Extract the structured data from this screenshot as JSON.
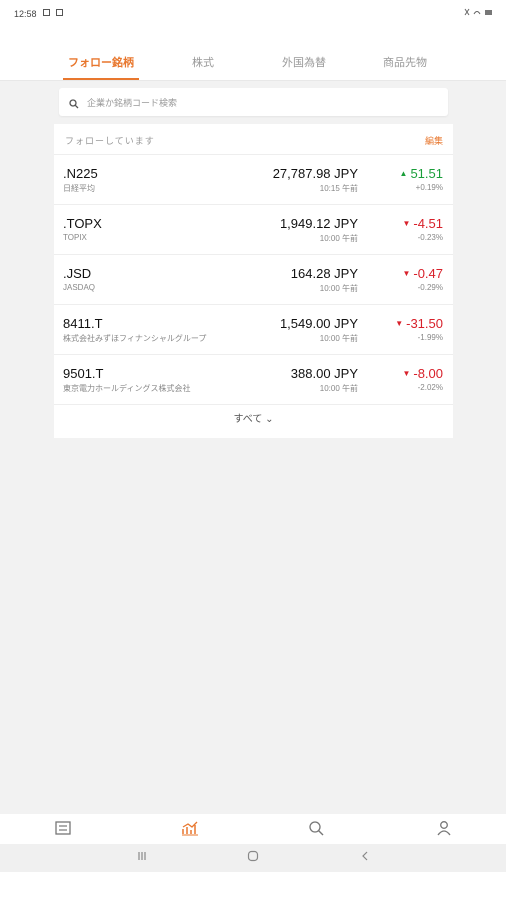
{
  "status": {
    "time": "12:58"
  },
  "tabs": [
    {
      "label": "フォロー銘柄",
      "active": true
    },
    {
      "label": "株式",
      "active": false
    },
    {
      "label": "外国為替",
      "active": false
    },
    {
      "label": "商品先物",
      "active": false
    }
  ],
  "search": {
    "placeholder": "企業か銘柄コード検索"
  },
  "watchlist": {
    "title": "フォローしています",
    "edit_label": "編集",
    "see_all": "すべて ⌄",
    "rows": [
      {
        "symbol": ".N225",
        "name": "日経平均",
        "price": "27,787.98 JPY",
        "time": "10:15 午前",
        "change": "51.51",
        "pct": "+0.19%",
        "direction": "up"
      },
      {
        "symbol": ".TOPX",
        "name": "TOPIX",
        "price": "1,949.12 JPY",
        "time": "10:00 午前",
        "change": "-4.51",
        "pct": "-0.23%",
        "direction": "down"
      },
      {
        "symbol": ".JSD",
        "name": "JASDAQ",
        "price": "164.28 JPY",
        "time": "10:00 午前",
        "change": "-0.47",
        "pct": "-0.29%",
        "direction": "down"
      },
      {
        "symbol": "8411.T",
        "name": "株式会社みずほフィナンシャルグループ",
        "price": "1,549.00 JPY",
        "time": "10:00 午前",
        "change": "-31.50",
        "pct": "-1.99%",
        "direction": "down"
      },
      {
        "symbol": "9501.T",
        "name": "東京電力ホールディングス株式会社",
        "price": "388.00 JPY",
        "time": "10:00 午前",
        "change": "-8.00",
        "pct": "-2.02%",
        "direction": "down"
      }
    ]
  },
  "bottom_nav": [
    {
      "icon": "news-icon",
      "active": false
    },
    {
      "icon": "markets-icon",
      "active": true
    },
    {
      "icon": "search-icon",
      "active": false
    },
    {
      "icon": "profile-icon",
      "active": false
    }
  ],
  "colors": {
    "accent": "#e8772e",
    "up": "#1a9e3a",
    "down": "#d8202a"
  }
}
